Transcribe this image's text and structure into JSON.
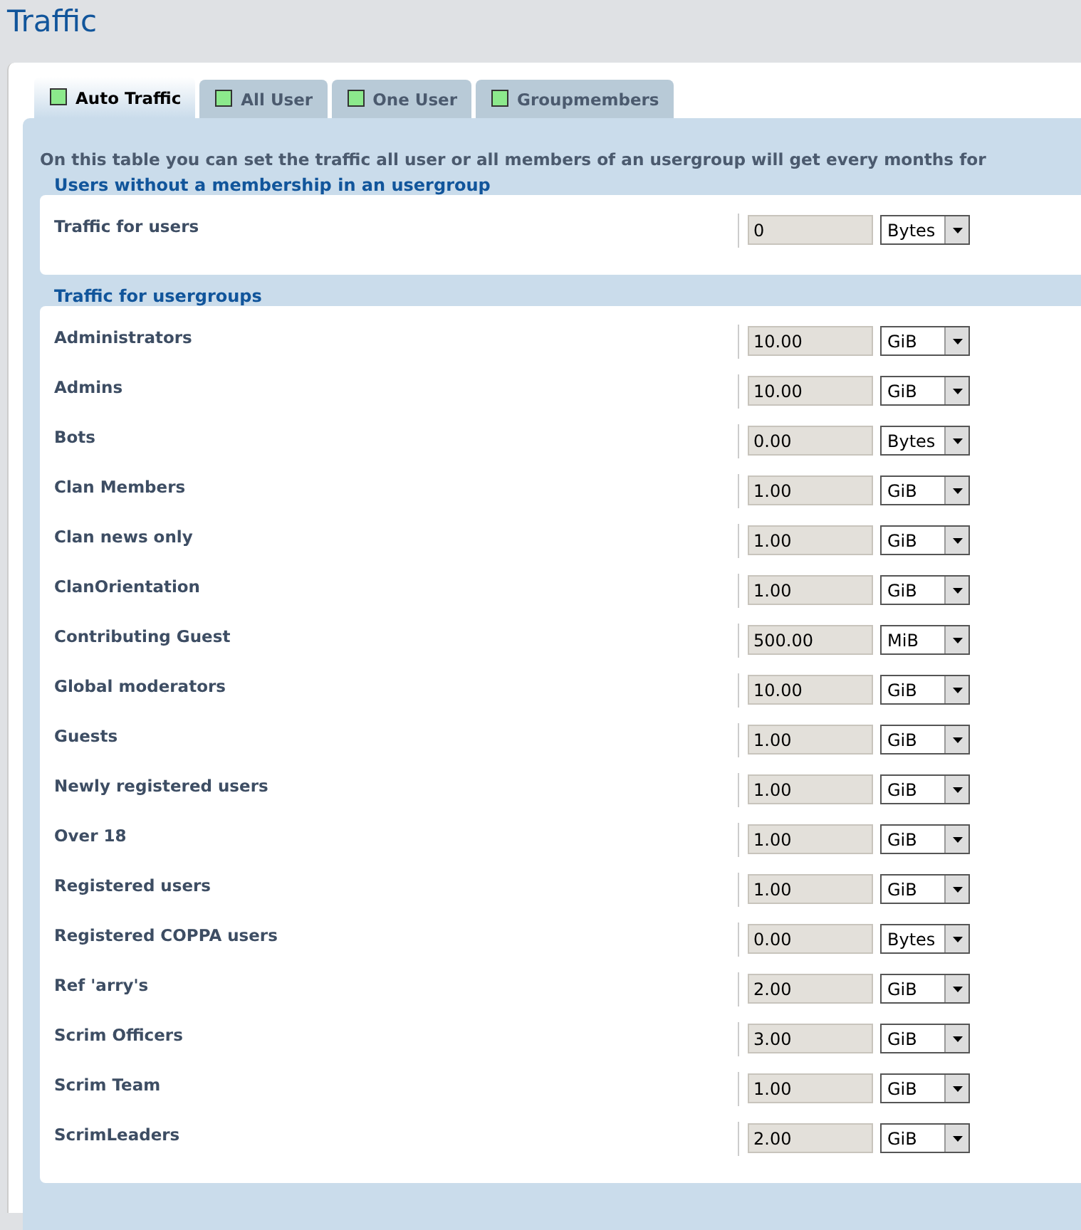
{
  "page_title": "Traffic",
  "tabs": [
    {
      "label": "Auto Traffic",
      "selected": true
    },
    {
      "label": "All User",
      "selected": false
    },
    {
      "label": "One User",
      "selected": false
    },
    {
      "label": "Groupmembers",
      "selected": false
    }
  ],
  "description": "On this table you can set the traffic all user or all members of an usergroup will get every months for",
  "sections": [
    {
      "title": "Users without a membership in an usergroup",
      "rows": [
        {
          "label": "Traffic for users",
          "value": "0",
          "unit": "Bytes"
        }
      ]
    },
    {
      "title": "Traffic for usergroups",
      "rows": [
        {
          "label": "Administrators",
          "value": "10.00",
          "unit": "GiB"
        },
        {
          "label": "Admins",
          "value": "10.00",
          "unit": "GiB"
        },
        {
          "label": "Bots",
          "value": "0.00",
          "unit": "Bytes"
        },
        {
          "label": "Clan Members",
          "value": "1.00",
          "unit": "GiB"
        },
        {
          "label": "Clan news only",
          "value": "1.00",
          "unit": "GiB"
        },
        {
          "label": "ClanOrientation",
          "value": "1.00",
          "unit": "GiB"
        },
        {
          "label": "Contributing Guest",
          "value": "500.00",
          "unit": "MiB"
        },
        {
          "label": "Global moderators",
          "value": "10.00",
          "unit": "GiB"
        },
        {
          "label": "Guests",
          "value": "1.00",
          "unit": "GiB"
        },
        {
          "label": "Newly registered users",
          "value": "1.00",
          "unit": "GiB"
        },
        {
          "label": "Over 18",
          "value": "1.00",
          "unit": "GiB"
        },
        {
          "label": "Registered users",
          "value": "1.00",
          "unit": "GiB"
        },
        {
          "label": "Registered COPPA users",
          "value": "0.00",
          "unit": "Bytes"
        },
        {
          "label": "Ref 'arry's",
          "value": "2.00",
          "unit": "GiB"
        },
        {
          "label": "Scrim Officers",
          "value": "3.00",
          "unit": "GiB"
        },
        {
          "label": "Scrim Team",
          "value": "1.00",
          "unit": "GiB"
        },
        {
          "label": "ScrimLeaders",
          "value": "2.00",
          "unit": "GiB"
        }
      ]
    }
  ]
}
